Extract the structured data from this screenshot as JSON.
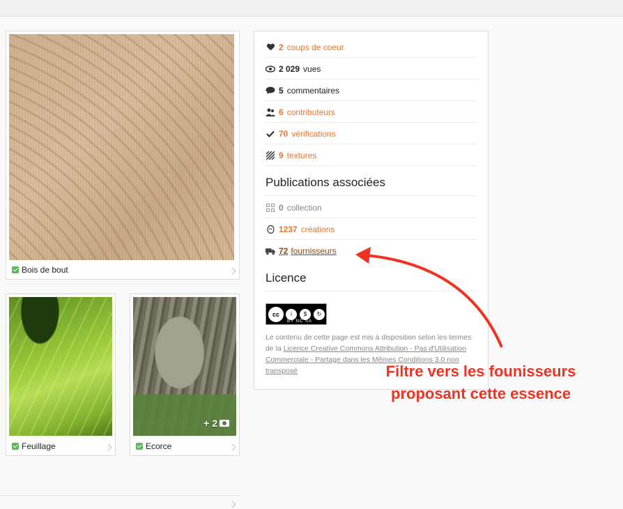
{
  "gallery": [
    {
      "label": "Bois de bout"
    },
    {
      "label": "Feuillage"
    },
    {
      "label": "Ecorce",
      "more_count": "+ 2"
    }
  ],
  "stats": [
    {
      "num": "2",
      "label": "coups de coeur",
      "icon": "heart-icon"
    },
    {
      "num": "2 029",
      "label": "vues",
      "icon": "eye-icon"
    },
    {
      "num": "5",
      "label": "commentaires",
      "icon": "comment-icon"
    },
    {
      "num": "6",
      "label": "contributeurs",
      "icon": "users-icon"
    },
    {
      "num": "70",
      "label": "vérifications",
      "icon": "check-icon"
    },
    {
      "num": "9",
      "label": "textures",
      "icon": "texture-icon"
    }
  ],
  "publications": {
    "title": "Publications associées",
    "items": [
      {
        "num": "0",
        "label": "collection",
        "icon": "grid-icon"
      },
      {
        "num": "1237",
        "label": "créations",
        "icon": "egg-icon"
      },
      {
        "num": "72",
        "label": "fournisseurs",
        "icon": "truck-icon"
      }
    ]
  },
  "licence": {
    "title": "Licence",
    "badge_tags": "BY  NC  SA",
    "text_before": "Le contenu de cette page est mis à disposition selon les termes de la ",
    "link_text": "Licence Creative Commons Attribution - Pas d'Utilisation Commerciale - Partage dans les Mêmes Conditions 3.0 non transposé"
  },
  "annotation": {
    "line1": "Filtre vers les founisseurs",
    "line2": "proposant cette essence"
  },
  "colors": {
    "accent": "#e8752a",
    "annotation": "#ee3322",
    "check": "#5cb85c"
  }
}
